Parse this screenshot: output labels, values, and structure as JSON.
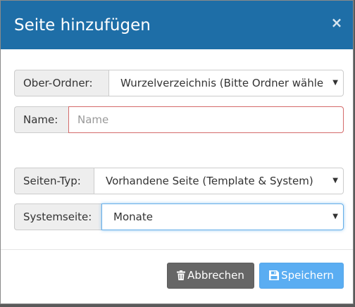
{
  "dialog": {
    "title": "Seite hinzufügen",
    "close_symbol": "×"
  },
  "form": {
    "parent_folder": {
      "label": "Ober-Ordner:",
      "value": "Wurzelverzeichnis (Bitte Ordner wähle"
    },
    "name": {
      "label": "Name:",
      "value": "",
      "placeholder": "Name"
    },
    "page_type": {
      "label": "Seiten-Typ:",
      "value": "Vorhandene Seite (Template & System)"
    },
    "system_page": {
      "label": "Systemseite:",
      "value": "Monate"
    }
  },
  "footer": {
    "cancel_label": "Abbrechen",
    "save_label": "Speichern"
  },
  "icons": {
    "close": "close-icon",
    "dropdown": "chevron-down-icon",
    "cancel": "trash-icon",
    "save": "save-icon"
  },
  "colors": {
    "header": "#1e6ea7",
    "cancel_button": "#666666",
    "save_button": "#5aadf2",
    "error_border": "#d46a6a",
    "focus_border": "#66afe9"
  }
}
